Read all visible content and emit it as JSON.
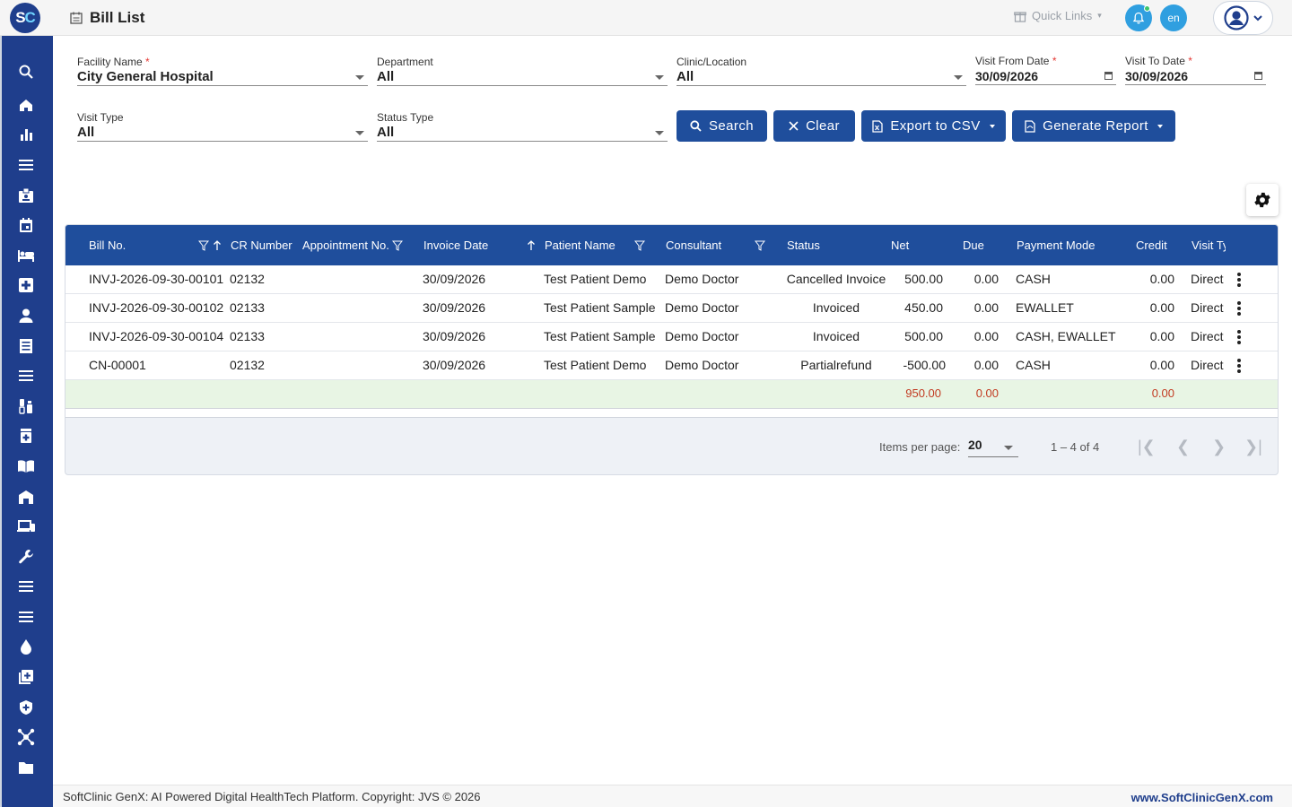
{
  "header": {
    "logo_text": "SC",
    "page_title": "Bill List",
    "quick_links": "Quick Links",
    "lang": "en"
  },
  "sidebar": {
    "icons": [
      "search-icon",
      "home-icon",
      "bar-chart-icon",
      "menu-icon",
      "badge-icon",
      "calendar-icon",
      "bed-icon",
      "medical-plus-icon",
      "person-icon",
      "receipt-icon",
      "list-icon",
      "lab-icon",
      "pharmacy-icon",
      "book-icon",
      "store-icon",
      "devices-icon",
      "wrench-icon",
      "menu-2-icon",
      "menu-3-icon",
      "drop-icon",
      "add-box-icon",
      "shield-icon",
      "network-icon",
      "folder-icon"
    ]
  },
  "filters": {
    "facility": {
      "label": "Facility Name",
      "value": "City General Hospital"
    },
    "department": {
      "label": "Department",
      "value": "All"
    },
    "clinic": {
      "label": "Clinic/Location",
      "value": "All"
    },
    "visit_from": {
      "label": "Visit From Date",
      "value": "30/09/2026"
    },
    "visit_to": {
      "label": "Visit To Date",
      "value": "30/09/2026"
    },
    "visit_type": {
      "label": "Visit Type",
      "value": "All"
    },
    "status_type": {
      "label": "Status Type",
      "value": "All"
    }
  },
  "buttons": {
    "search": "Search",
    "clear": "Clear",
    "export": "Export to CSV",
    "report": "Generate Report"
  },
  "table": {
    "headers": [
      "Bill No.",
      "CR Number",
      "Appointment No.",
      "Invoice Date",
      "Patient Name",
      "Consultant",
      "Status",
      "Net",
      "Due",
      "Payment Mode",
      "Credit",
      "Visit Ty"
    ],
    "rows": [
      {
        "bill_no": "INVJ-2026-09-30-00101",
        "cr": "02132",
        "appt": "",
        "date": "30/09/2026",
        "patient": "Test Patient Demo",
        "consultant": "Demo Doctor",
        "status": "Cancelled Invoice",
        "net": "500.00",
        "due": "0.00",
        "mode": "CASH",
        "credit": "0.00",
        "visit": "Direct"
      },
      {
        "bill_no": "INVJ-2026-09-30-00102",
        "cr": "02133",
        "appt": "",
        "date": "30/09/2026",
        "patient": "Test Patient Sample",
        "consultant": "Demo Doctor",
        "status": "Invoiced",
        "net": "450.00",
        "due": "0.00",
        "mode": "EWALLET",
        "credit": "0.00",
        "visit": "Direct"
      },
      {
        "bill_no": "INVJ-2026-09-30-00104",
        "cr": "02133",
        "appt": "",
        "date": "30/09/2026",
        "patient": "Test Patient Sample",
        "consultant": "Demo Doctor",
        "status": "Invoiced",
        "net": "500.00",
        "due": "0.00",
        "mode": "CASH, EWALLET",
        "credit": "0.00",
        "visit": "Direct"
      },
      {
        "bill_no": "CN-00001",
        "cr": "02132",
        "appt": "",
        "date": "30/09/2026",
        "patient": "Test Patient Demo",
        "consultant": "Demo Doctor",
        "status": "Partialrefund",
        "net": "-500.00",
        "due": "0.00",
        "mode": "CASH",
        "credit": "0.00",
        "visit": "Direct"
      }
    ],
    "totals": {
      "net": "950.00",
      "due": "0.00",
      "credit": "0.00"
    }
  },
  "paginator": {
    "label": "Items per page:",
    "page_size": "20",
    "range": "1 – 4 of 4"
  },
  "footer": {
    "left": "SoftClinic GenX: AI Powered Digital HealthTech Platform. Copyright: JVS © 2026",
    "right": "www.SoftClinicGenX.com"
  },
  "colors": {
    "primary": "#1f4e9c",
    "sidebar": "#1f3e8c",
    "accent": "#2f9fe0",
    "total_text": "#c23b22",
    "total_bg": "#e8f5e4"
  }
}
